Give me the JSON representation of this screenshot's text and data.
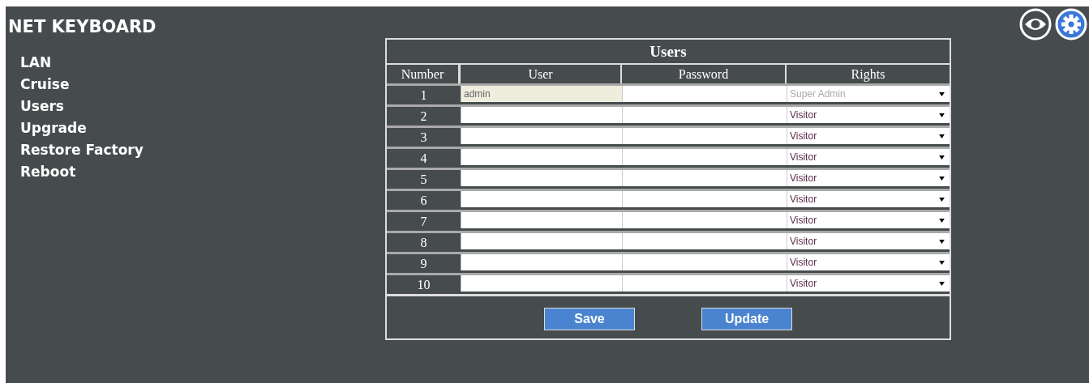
{
  "app_title": "NET  KEYBOARD",
  "sidebar": {
    "items": [
      {
        "label": "LAN"
      },
      {
        "label": "Cruise"
      },
      {
        "label": "Users"
      },
      {
        "label": "Upgrade"
      },
      {
        "label": "Restore Factory"
      },
      {
        "label": "Reboot"
      }
    ]
  },
  "table": {
    "title": "Users",
    "columns": [
      "Number",
      "User",
      "Password",
      "Rights"
    ],
    "rows": [
      {
        "number": "1",
        "user": "admin",
        "rights": "Super Admin",
        "disabled": true
      },
      {
        "number": "2",
        "rights": "Visitor",
        "disabled": false
      },
      {
        "number": "3",
        "rights": "Visitor",
        "disabled": false
      },
      {
        "number": "4",
        "rights": "Visitor",
        "disabled": false
      },
      {
        "number": "5",
        "rights": "Visitor",
        "disabled": false
      },
      {
        "number": "6",
        "rights": "Visitor",
        "disabled": false
      },
      {
        "number": "7",
        "rights": "Visitor",
        "disabled": false
      },
      {
        "number": "8",
        "rights": "Visitor",
        "disabled": false
      },
      {
        "number": "9",
        "rights": "Visitor",
        "disabled": false
      },
      {
        "number": "10",
        "rights": "Visitor",
        "disabled": false
      }
    ]
  },
  "buttons": [
    "Save",
    "Update"
  ]
}
